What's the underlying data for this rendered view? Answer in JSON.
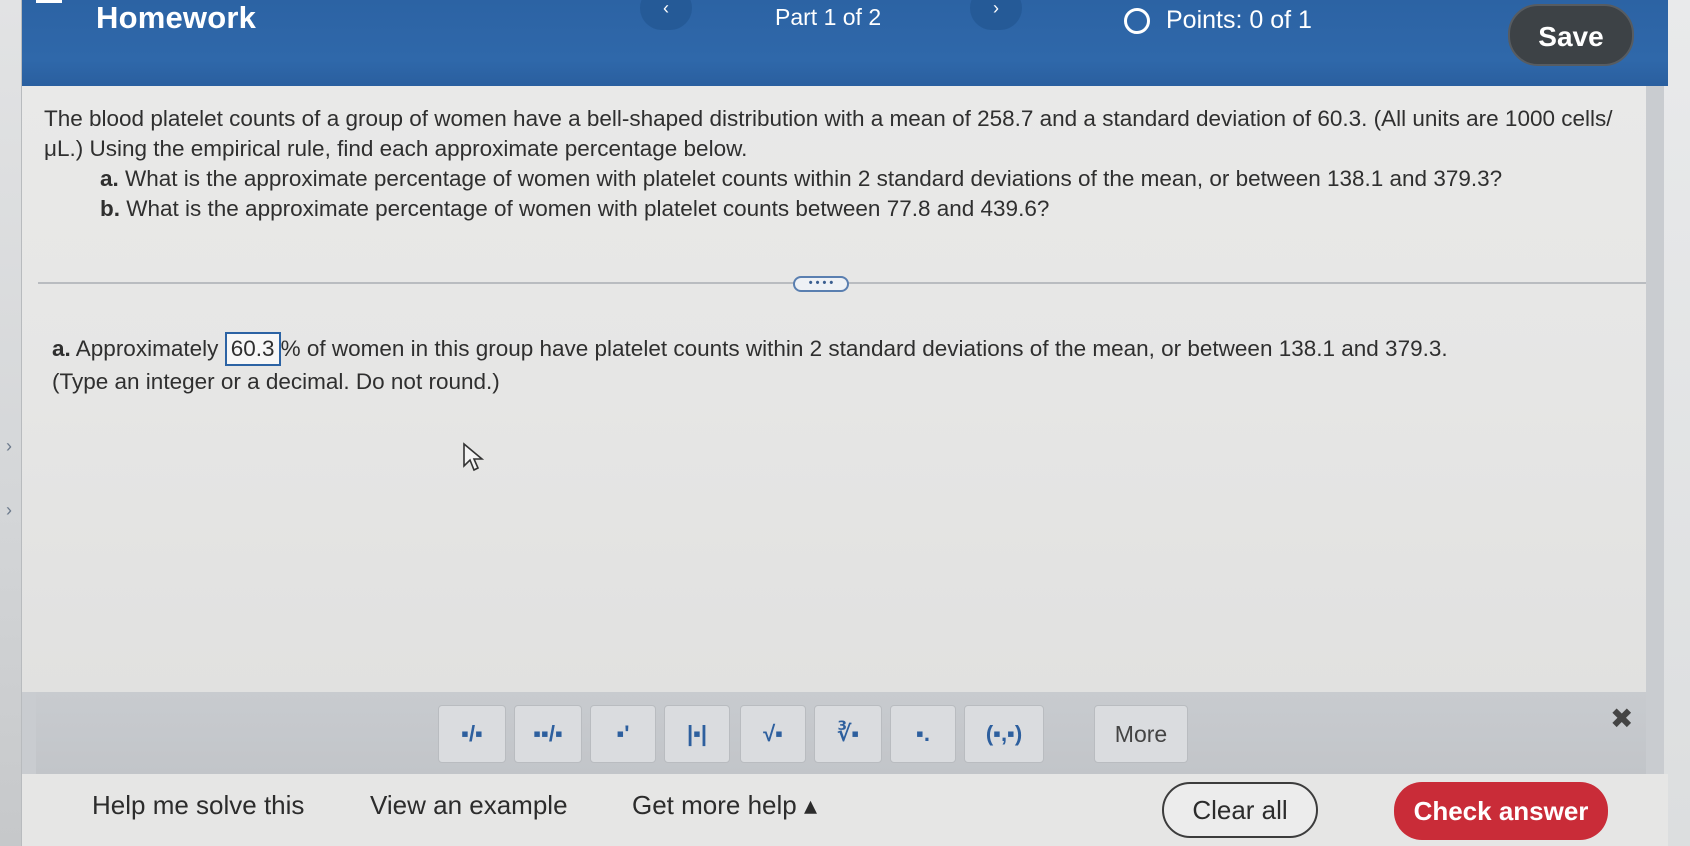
{
  "header": {
    "title": "Homework",
    "part": "Part 1 of 2",
    "nav_prev": "‹",
    "nav_next": "›",
    "points": "Points: 0 of 1",
    "save_label": "Save"
  },
  "question": {
    "intro": "The blood platelet counts of a group of women have a bell-shaped distribution with a mean of 258.7 and a standard deviation of 60.3. (All units are 1000 cells/μL.) Using the empirical rule, find each approximate percentage below.",
    "part_a_label": "a.",
    "part_a": "What is the approximate percentage of women with platelet counts within 2 standard deviations of the mean, or between 138.1 and 379.3?",
    "part_b_label": "b.",
    "part_b": "What is the approximate percentage of women with platelet counts between 77.8 and 439.6?"
  },
  "more_handle": "• • • •",
  "answer": {
    "label": "a.",
    "prefix": "Approximately",
    "value": "60.3",
    "suffix": "% of women in this group have platelet counts within 2 standard deviations of the mean, or between 138.1 and 379.3.",
    "hint": "(Type an integer or a decimal. Do not round.)"
  },
  "toolbar": {
    "tools": [
      {
        "name": "fraction-tool",
        "glyph": "▪/▪"
      },
      {
        "name": "mixed-number-tool",
        "glyph": "▪▪/▪"
      },
      {
        "name": "exponent-tool",
        "glyph": "▪'"
      },
      {
        "name": "absolute-value-tool",
        "glyph": "|▪|"
      },
      {
        "name": "square-root-tool",
        "glyph": "√▪"
      },
      {
        "name": "nth-root-tool",
        "glyph": "∛▪"
      },
      {
        "name": "subscript-tool",
        "glyph": "▪."
      },
      {
        "name": "ordered-pair-tool",
        "glyph": "(▪,▪)"
      }
    ],
    "more_label": "More",
    "close_glyph": "✖"
  },
  "bottom": {
    "help_label": "Help me solve this",
    "example_label": "View an example",
    "more_help_label": "Get more help ▴",
    "clear_label": "Clear all",
    "check_label": "Check answer"
  },
  "colors": {
    "header_blue": "#2c63a4",
    "save_bg": "#3d4246",
    "check_red": "#c92c38",
    "answer_box_border": "#2c63a4"
  }
}
